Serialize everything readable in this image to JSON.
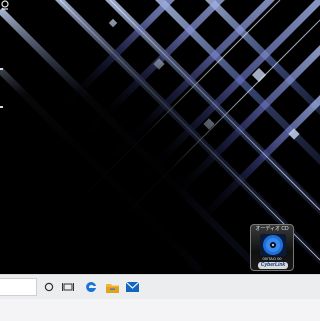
{
  "desktop": {
    "wallpaper": "blue-glass-grid",
    "colors": {
      "grid_light": "#a9c1ea",
      "grid_glow": "#6d6fd8",
      "background": "#000000"
    }
  },
  "gadget": {
    "title": "オーディオ CD",
    "counter": "00/TAO 00",
    "brand": "CyberLink",
    "icon": "disc-icon",
    "accent": "#1f6fd6"
  },
  "taskbar": {
    "background": "#ecedef",
    "icons": [
      "search-box",
      "cortana-icon",
      "task-view-icon",
      "edge-icon",
      "file-explorer-icon",
      "mail-icon"
    ],
    "accents": {
      "edge": "#1a73d9",
      "explorer": "#f2b632",
      "mail": "#1565c0"
    }
  }
}
